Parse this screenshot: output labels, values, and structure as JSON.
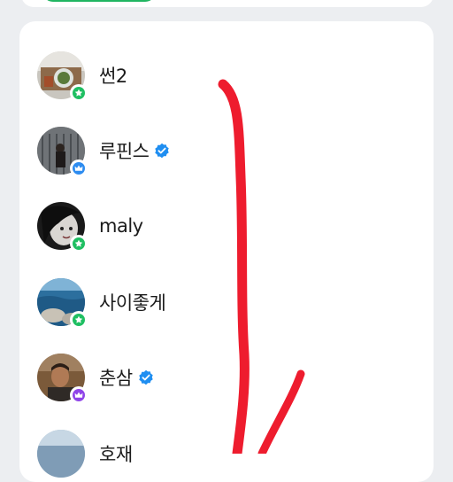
{
  "colors": {
    "background": "#eceef1",
    "card": "#ffffff",
    "green_badge": "#1fbf62",
    "blue_badge": "#2d8cf0",
    "purple_badge": "#8f44e8",
    "verified": "#1f8ef1",
    "annotation": "#ee1c2e"
  },
  "users": [
    {
      "name": "썬2",
      "badge": "green-star-icon",
      "verified": false
    },
    {
      "name": "루핀스",
      "badge": "blue-crown-icon",
      "verified": true
    },
    {
      "name": "maly",
      "badge": "green-star-icon",
      "verified": false
    },
    {
      "name": "사이좋게",
      "badge": "green-star-icon",
      "verified": false
    },
    {
      "name": "춘삼",
      "badge": "purple-crown-icon",
      "verified": true
    },
    {
      "name": "호재",
      "badge": "",
      "verified": false
    }
  ]
}
